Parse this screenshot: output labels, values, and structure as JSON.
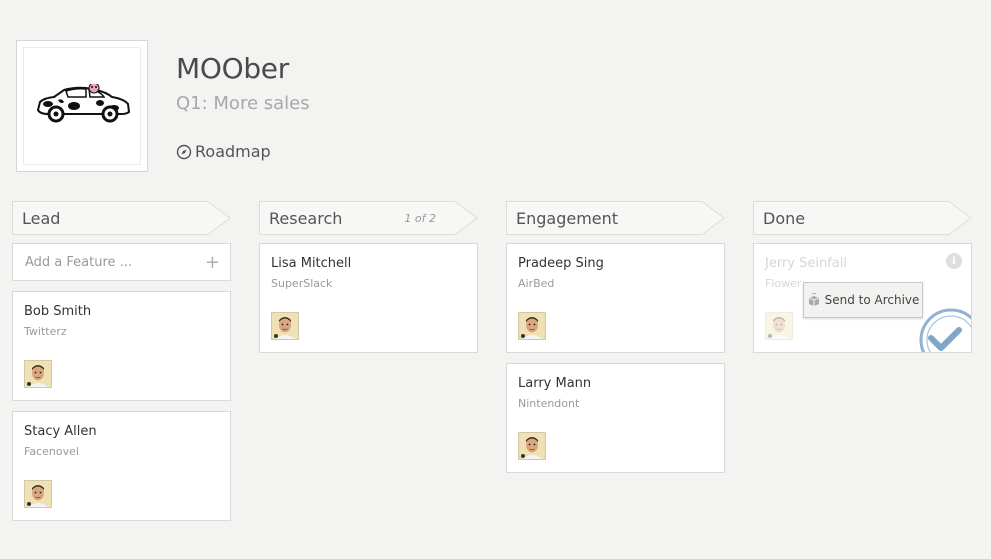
{
  "app": {
    "title": "MOOber",
    "subtitle": "Q1: More sales",
    "roadmap_label": "Roadmap"
  },
  "columns": [
    {
      "title": "Lead",
      "count": "",
      "add_placeholder": "Add a Feature ...",
      "cards": [
        {
          "name": "Bob Smith",
          "company": "Twitterz"
        },
        {
          "name": "Stacy Allen",
          "company": "Facenovel"
        }
      ]
    },
    {
      "title": "Research",
      "count": "1 of 2",
      "cards": [
        {
          "name": "Lisa Mitchell",
          "company": "SuperSlack"
        }
      ]
    },
    {
      "title": "Engagement",
      "count": "",
      "cards": [
        {
          "name": "Pradeep Sing",
          "company": "AirBed"
        },
        {
          "name": "Larry Mann",
          "company": "Nintendont"
        }
      ]
    },
    {
      "title": "Done",
      "count": "",
      "cards": [
        {
          "name": "Jerry Seinfall",
          "company": "Flower"
        }
      ],
      "archive_label": "Send to Archive"
    }
  ],
  "colors": {
    "background": "#f3f3f1",
    "card_border": "#d9d9d7",
    "header_fill": "#f7f7f6",
    "stamp_blue": "#7fa6c9"
  },
  "icons": {
    "roadmap": "compass-icon",
    "add": "plus-icon",
    "info": "info-icon",
    "archive": "box-icon",
    "stamp": "checkmark-stamp-icon"
  }
}
